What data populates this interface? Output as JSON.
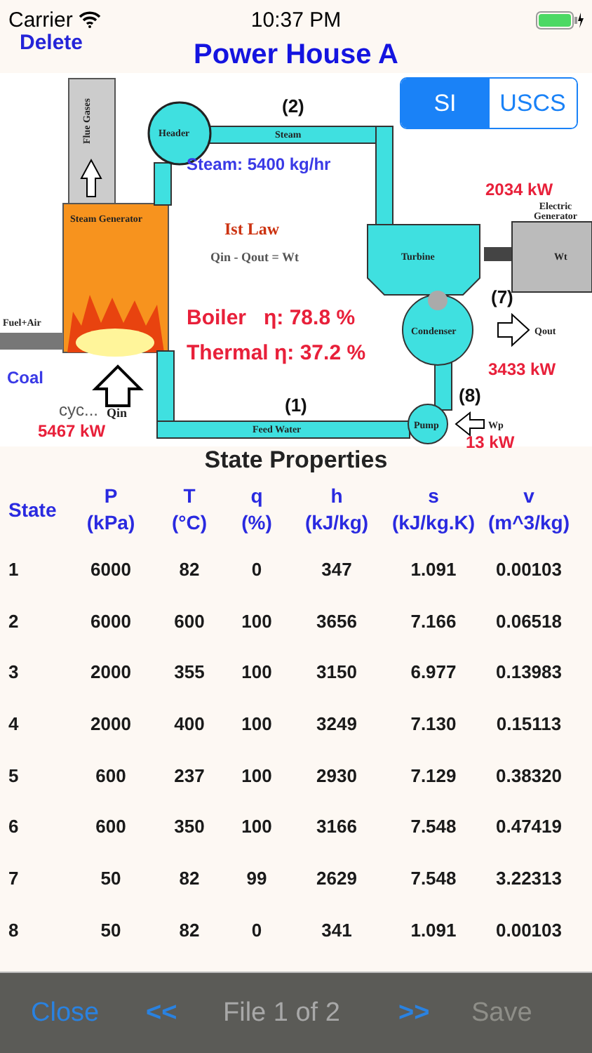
{
  "status_bar": {
    "carrier": "Carrier",
    "time": "10:37 PM"
  },
  "nav": {
    "delete": "Delete",
    "title": "Power House A"
  },
  "unit_toggle": [
    {
      "label": "SI",
      "selected": true
    },
    {
      "label": "USCS",
      "selected": false
    }
  ],
  "diagram": {
    "flue_gases": "Flue Gases",
    "header": "Header",
    "steam": "Steam",
    "steam_generator": "Steam Generator",
    "fuel_air": "Fuel+Air",
    "law_title": "Ist Law",
    "law": "Qin - Qout = Wt",
    "turbine": "Turbine",
    "generator": "Electric Generator",
    "wt": "Wt",
    "condenser": "Condenser",
    "qout": "Qout",
    "pump": "Pump",
    "wp": "Wp",
    "feed_water": "Feed Water",
    "qin": "Qin",
    "state_2": "(2)",
    "state_7": "(7)",
    "state_8": "(8)",
    "state_1": "(1)",
    "steam_flow": "Steam: 5400 kg/hr",
    "work_out": "2034 kW",
    "boiler_eff": "Boiler   η: 78.8 %",
    "thermal_eff": "Thermal η: 37.2 %",
    "heat_out": "3433 kW",
    "pump_work": "13 kW",
    "fuel": "Coal",
    "cycle_qin": "cyc...",
    "heat_in": "5467 kW"
  },
  "table": {
    "title": "State Properties",
    "columns": [
      {
        "name": "State"
      },
      {
        "name": "P",
        "unit": "(kPa)"
      },
      {
        "name": "T",
        "unit": "(°C)"
      },
      {
        "name": "q",
        "unit": "(%)"
      },
      {
        "name": "h",
        "unit": "(kJ/kg)"
      },
      {
        "name": "s",
        "unit": "(kJ/kg.K)"
      },
      {
        "name": "v",
        "unit": "(m^3/kg)"
      }
    ],
    "rows": [
      [
        "1",
        "6000",
        "82",
        "0",
        "347",
        "1.091",
        "0.00103"
      ],
      [
        "2",
        "6000",
        "600",
        "100",
        "3656",
        "7.166",
        "0.06518"
      ],
      [
        "3",
        "2000",
        "355",
        "100",
        "3150",
        "6.977",
        "0.13983"
      ],
      [
        "4",
        "2000",
        "400",
        "100",
        "3249",
        "7.130",
        "0.15113"
      ],
      [
        "5",
        "600",
        "237",
        "100",
        "2930",
        "7.129",
        "0.38320"
      ],
      [
        "6",
        "600",
        "350",
        "100",
        "3166",
        "7.548",
        "0.47419"
      ],
      [
        "7",
        "50",
        "82",
        "99",
        "2629",
        "7.548",
        "3.22313"
      ],
      [
        "8",
        "50",
        "82",
        "0",
        "341",
        "1.091",
        "0.00103"
      ]
    ]
  },
  "toolbar": {
    "close": "Close",
    "prev": "<<",
    "page": "File 1 of 2",
    "next": ">>",
    "save": {
      "label": "Save",
      "disabled": true
    }
  }
}
